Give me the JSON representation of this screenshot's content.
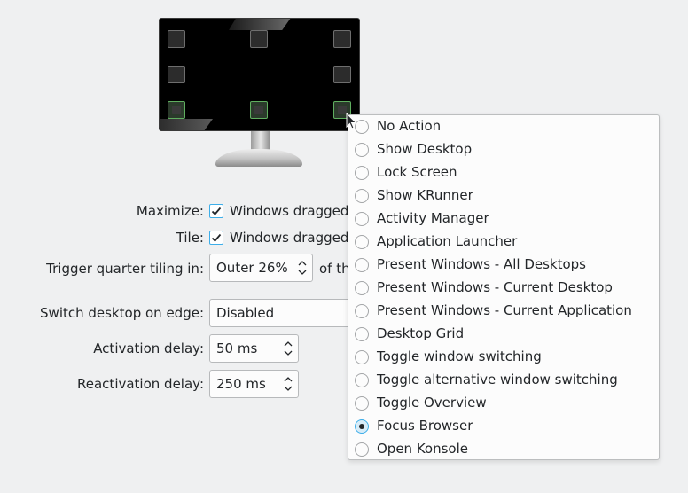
{
  "monitor": {
    "corners": [
      {
        "name": "corner-top-left",
        "active": false
      },
      {
        "name": "corner-top",
        "active": false
      },
      {
        "name": "corner-top-right",
        "active": false
      },
      {
        "name": "corner-left",
        "active": false
      },
      {
        "name": "corner-right",
        "active": false
      },
      {
        "name": "corner-bottom-left",
        "active": true
      },
      {
        "name": "corner-bottom",
        "active": true
      },
      {
        "name": "corner-bottom-right",
        "active": true
      }
    ]
  },
  "form": {
    "maximize_label": "Maximize:",
    "maximize_checkbox_text": "Windows dragged",
    "maximize_checked": true,
    "tile_label": "Tile:",
    "tile_checkbox_text": "Windows dragged",
    "tile_checked": true,
    "quarter_label": "Trigger quarter tiling in:",
    "quarter_value": "Outer 26%",
    "quarter_suffix": "of th",
    "switch_label": "Switch desktop on edge:",
    "switch_value": "Disabled",
    "activation_label": "Activation delay:",
    "activation_value": "50 ms",
    "reactivation_label": "Reactivation delay:",
    "reactivation_value": "250 ms"
  },
  "menu": {
    "items": [
      {
        "label": "No Action",
        "checked": false
      },
      {
        "label": "Show Desktop",
        "checked": false
      },
      {
        "label": "Lock Screen",
        "checked": false
      },
      {
        "label": "Show KRunner",
        "checked": false
      },
      {
        "label": "Activity Manager",
        "checked": false
      },
      {
        "label": "Application Launcher",
        "checked": false
      },
      {
        "label": "Present Windows - All Desktops",
        "checked": false
      },
      {
        "label": "Present Windows - Current Desktop",
        "checked": false
      },
      {
        "label": "Present Windows - Current Application",
        "checked": false
      },
      {
        "label": "Desktop Grid",
        "checked": false
      },
      {
        "label": "Toggle window switching",
        "checked": false
      },
      {
        "label": "Toggle alternative window switching",
        "checked": false
      },
      {
        "label": "Toggle Overview",
        "checked": false
      },
      {
        "label": "Focus Browser",
        "checked": true
      },
      {
        "label": "Open Konsole",
        "checked": false
      }
    ]
  },
  "colors": {
    "accent": "#3daee9",
    "active_corner": "#5fae5f",
    "background": "#eff0f1"
  }
}
